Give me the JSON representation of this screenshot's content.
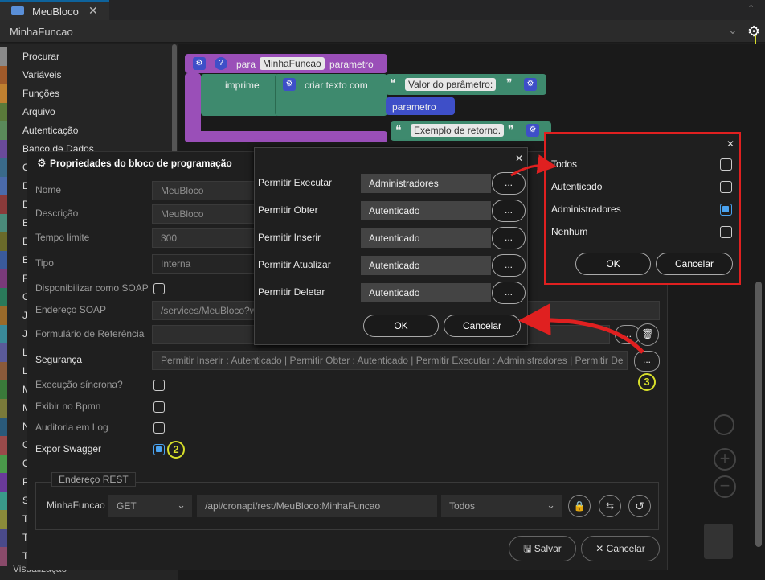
{
  "tab": {
    "title": "MeuBloco",
    "close": "✕",
    "chevron": "⌃"
  },
  "funcbar": {
    "name": "MinhaFuncao",
    "chevron": "⌄",
    "gear": "⚙"
  },
  "sidebar": {
    "items": [
      {
        "label": "Procurar",
        "color": "#8a8a8a"
      },
      {
        "label": "Variáveis",
        "color": "#a05a2a"
      },
      {
        "label": "Funções",
        "color": "#c08030"
      },
      {
        "label": "Arquivo",
        "color": "#5a7a3a"
      },
      {
        "label": "Autenticação",
        "color": "#5a8a5a"
      },
      {
        "label": "Banco de Dados",
        "color": "#6a4a9a"
      },
      {
        "label": "C",
        "color": "#3a6a8a"
      },
      {
        "label": "D",
        "color": "#4a6aaa"
      },
      {
        "label": "D",
        "color": "#8a3a3a"
      },
      {
        "label": "E",
        "color": "#4a8a7a"
      },
      {
        "label": "E",
        "color": "#6a6a2a"
      },
      {
        "label": "E",
        "color": "#3a5a9a"
      },
      {
        "label": "F",
        "color": "#7a3a7a"
      },
      {
        "label": "G",
        "color": "#2a7a5a"
      },
      {
        "label": "J",
        "color": "#9a6a2a"
      },
      {
        "label": "J",
        "color": "#3a8a9a"
      },
      {
        "label": "L",
        "color": "#5a5a9a"
      },
      {
        "label": "L",
        "color": "#8a5a3a"
      },
      {
        "label": "M",
        "color": "#3a7a3a"
      },
      {
        "label": "M",
        "color": "#7a7a3a"
      },
      {
        "label": "N",
        "color": "#2a5a7a"
      },
      {
        "label": "O",
        "color": "#9a4a4a"
      },
      {
        "label": "O",
        "color": "#4a9a4a"
      },
      {
        "label": "P",
        "color": "#6a3a9a"
      },
      {
        "label": "S",
        "color": "#3a9a8a"
      },
      {
        "label": "T",
        "color": "#8a8a3a"
      },
      {
        "label": "T",
        "color": "#4a4a8a"
      },
      {
        "label": "T",
        "color": "#8a4a6a"
      }
    ],
    "footer": "Visualização"
  },
  "blocks": {
    "header_para": "para",
    "func_name": "MinhaFuncao",
    "param_label": "parametro",
    "imprime": "imprime",
    "criar_texto": "criar texto com",
    "text1": "Valor do parâmetro:",
    "param_var": "parametro",
    "text2": "Exemplo de retorno.",
    "quote_open": "❝",
    "quote_close": "❞",
    "gear": "⚙",
    "help": "?"
  },
  "main_dialog": {
    "title": "Propriedades do bloco de programação",
    "fields": [
      {
        "label": "Nome",
        "value": "MeuBloco"
      },
      {
        "label": "Descrição",
        "value": "MeuBloco"
      },
      {
        "label": "Tempo limite",
        "value": "300"
      },
      {
        "label": "Tipo",
        "value": "Interna"
      },
      {
        "label": "Disponibilizar como SOAP"
      },
      {
        "label": "Endereço SOAP",
        "value": "/services/MeuBloco?w"
      },
      {
        "label": "Formulário de Referência",
        "value": ""
      },
      {
        "label": "Segurança",
        "value": "Permitir Inserir : Autenticado | Permitir Obter : Autenticado | Permitir Executar : Administradores | Permitir De"
      },
      {
        "label": "Execução síncrona?"
      },
      {
        "label": "Exibir no Bpmn"
      },
      {
        "label": "Auditoria em Log"
      },
      {
        "label": "Expor Swagger"
      }
    ],
    "dots": "...",
    "rest": {
      "legend": "Endereço REST",
      "name": "MinhaFuncao",
      "method": "GET",
      "path": "/api/cronapi/rest/MeuBloco:MinhaFuncao",
      "role": "Todos"
    },
    "save_label": "Salvar",
    "cancel_label": "Cancelar"
  },
  "perm_dialog": {
    "close": "✕",
    "rows": [
      {
        "label": "Permitir Executar",
        "value": "Administradores"
      },
      {
        "label": "Permitir Obter",
        "value": "Autenticado"
      },
      {
        "label": "Permitir Inserir",
        "value": "Autenticado"
      },
      {
        "label": "Permitir Atualizar",
        "value": "Autenticado"
      },
      {
        "label": "Permitir Deletar",
        "value": "Autenticado"
      }
    ],
    "dots": "...",
    "ok": "OK",
    "cancel": "Cancelar"
  },
  "roles_dialog": {
    "close": "✕",
    "roles": [
      {
        "label": "Todos",
        "checked": false
      },
      {
        "label": "Autenticado",
        "checked": false
      },
      {
        "label": "Administradores",
        "checked": true
      },
      {
        "label": "Nenhum",
        "checked": false
      }
    ],
    "ok": "OK",
    "cancel": "Cancelar"
  },
  "badges": [
    "1",
    "2",
    "3"
  ],
  "colors": {
    "annotation_red": "#e02020",
    "badge_yellow": "#d8e02a",
    "checkbox_blue": "#4aa3f0"
  }
}
